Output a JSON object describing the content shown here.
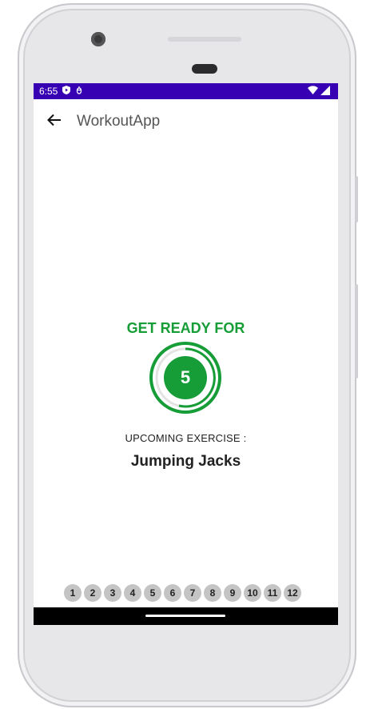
{
  "status_bar": {
    "time": "6:55",
    "bg_color": "#3700b3"
  },
  "app_bar": {
    "title": "WorkoutApp",
    "back_icon": "arrow-left-icon"
  },
  "main": {
    "heading": "GET READY FOR",
    "countdown": "5",
    "upcoming_label": "UPCOMING EXERCISE :",
    "exercise_name": "Jumping Jacks",
    "accent_color": "#169d37"
  },
  "exercise_steps": [
    "1",
    "2",
    "3",
    "4",
    "5",
    "6",
    "7",
    "8",
    "9",
    "10",
    "11",
    "12"
  ]
}
